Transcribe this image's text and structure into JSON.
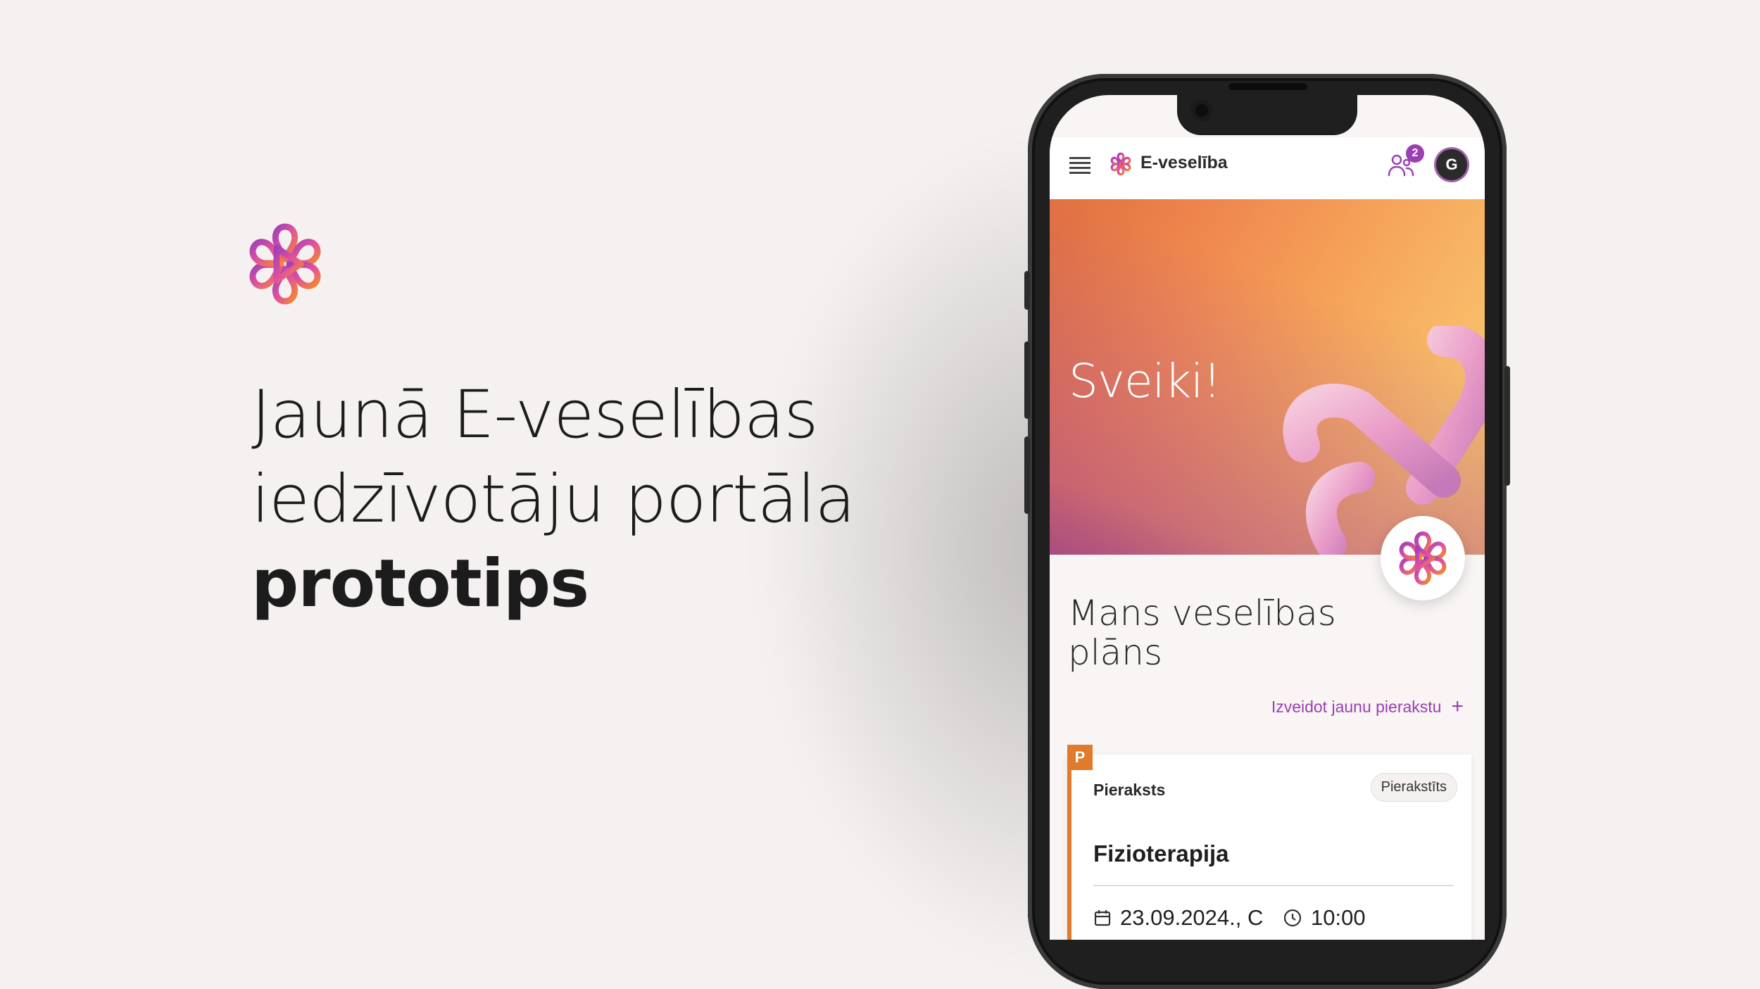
{
  "headline": {
    "line1": "Jaunā E-veselības",
    "line2": "iedzīvotāju portāla",
    "line3": "prototips"
  },
  "colors": {
    "background": "#f4f1f0",
    "brand_purple": "#9b3fb3",
    "brand_orange": "#e07a2c",
    "brand_pink": "#e0529c"
  },
  "app": {
    "title": "E-veselība",
    "menu_icon": "hamburger-icon",
    "notifications_count": "2",
    "avatar_initial": "G"
  },
  "hero": {
    "greeting": "Sveiki!"
  },
  "plan": {
    "title": "Mans veselības plāns",
    "create_link": "Izveidot jaunu pierakstu",
    "create_icon": "+"
  },
  "card": {
    "tag": "P",
    "type": "Pieraksts",
    "status": "Pierakstīts",
    "name": "Fizioterapija",
    "date": "23.09.2024., C",
    "time": "10:00"
  }
}
